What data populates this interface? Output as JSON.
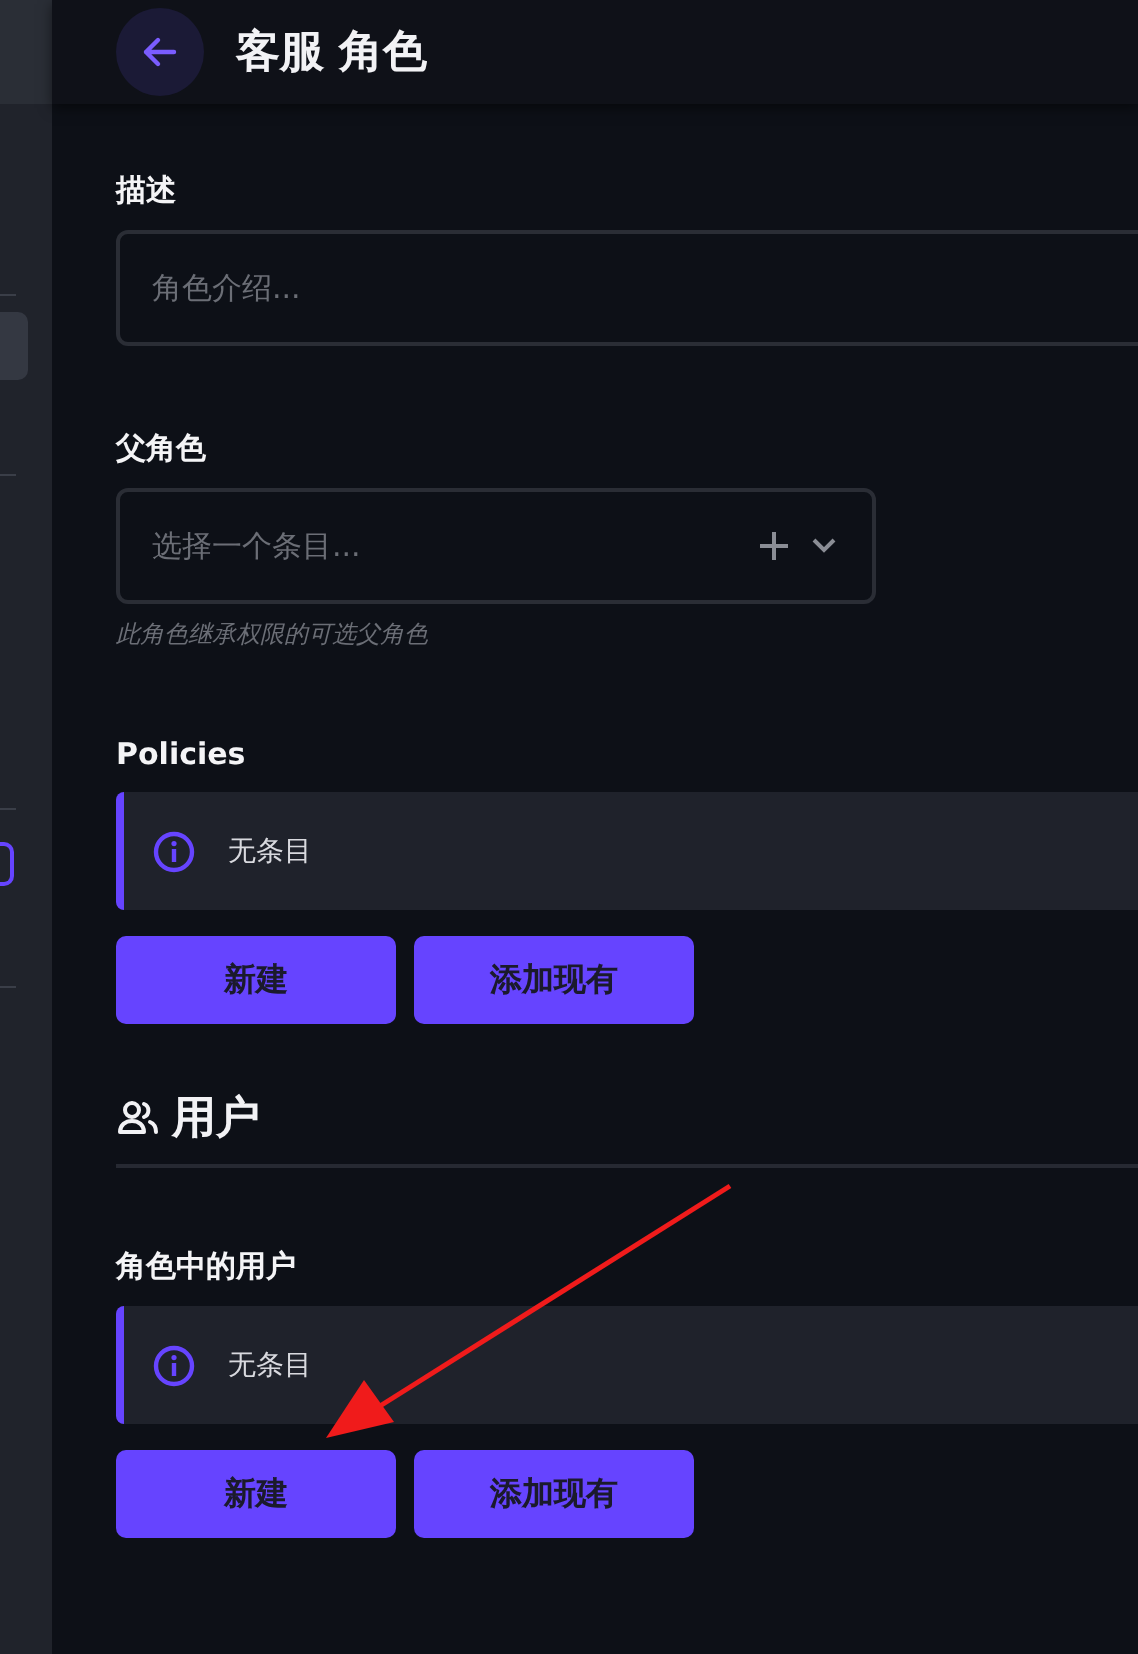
{
  "header": {
    "title": "客服 角色"
  },
  "description_field": {
    "label": "描述",
    "placeholder": "角色介绍..."
  },
  "parent_role_field": {
    "label": "父角色",
    "placeholder": "选择一个条目...",
    "hint": "此角色继承权限的可选父角色"
  },
  "policies": {
    "label": "Policies",
    "empty_text": "无条目",
    "buttons": [
      "新建",
      "添加现有"
    ]
  },
  "users_section": {
    "title": "用户",
    "label": "角色中的用户",
    "empty_text": "无条目",
    "buttons": [
      "新建",
      "添加现有"
    ]
  },
  "annotations": [
    {
      "kind": "arrow"
    }
  ]
}
